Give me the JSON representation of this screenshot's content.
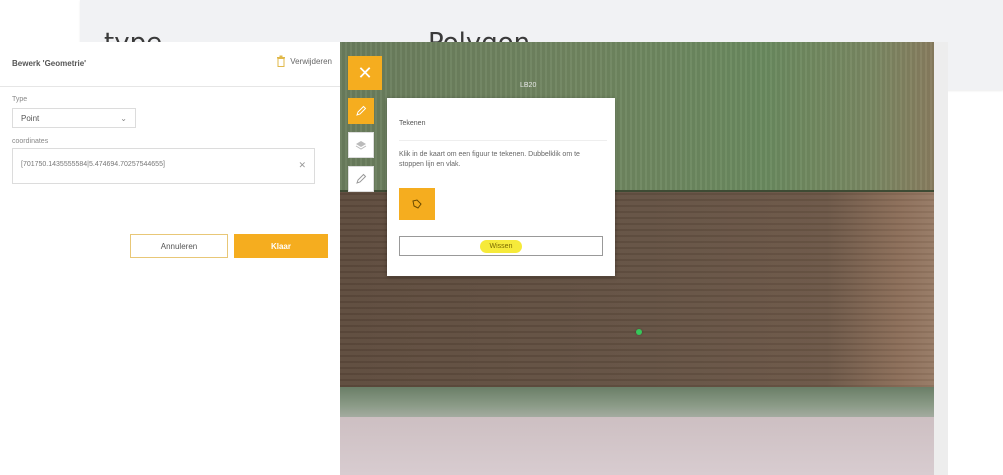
{
  "topbar": {
    "type_label": "type",
    "type_value": "Polygon"
  },
  "panel": {
    "title": "Bewerk 'Geometrie'",
    "delete_label": "Verwijderen",
    "type_field_label": "Type",
    "type_value": "Point",
    "coords_field_label": "coordinates",
    "coords_value": "[701750.1435555584|5.474694.70257544655]",
    "cancel_label": "Annuleren",
    "done_label": "Klaar"
  },
  "map": {
    "parcel_label": "LB20"
  },
  "draw_popup": {
    "title": "Tekenen",
    "instructions": "Klik in de kaart om een figuur te tekenen. Dubbelklik om te stoppen lijn en vlak.",
    "clear_label": "Wissen"
  },
  "colors": {
    "accent": "#f5ad1f",
    "highlight": "#f6ea3a",
    "marker": "#36c75a"
  }
}
